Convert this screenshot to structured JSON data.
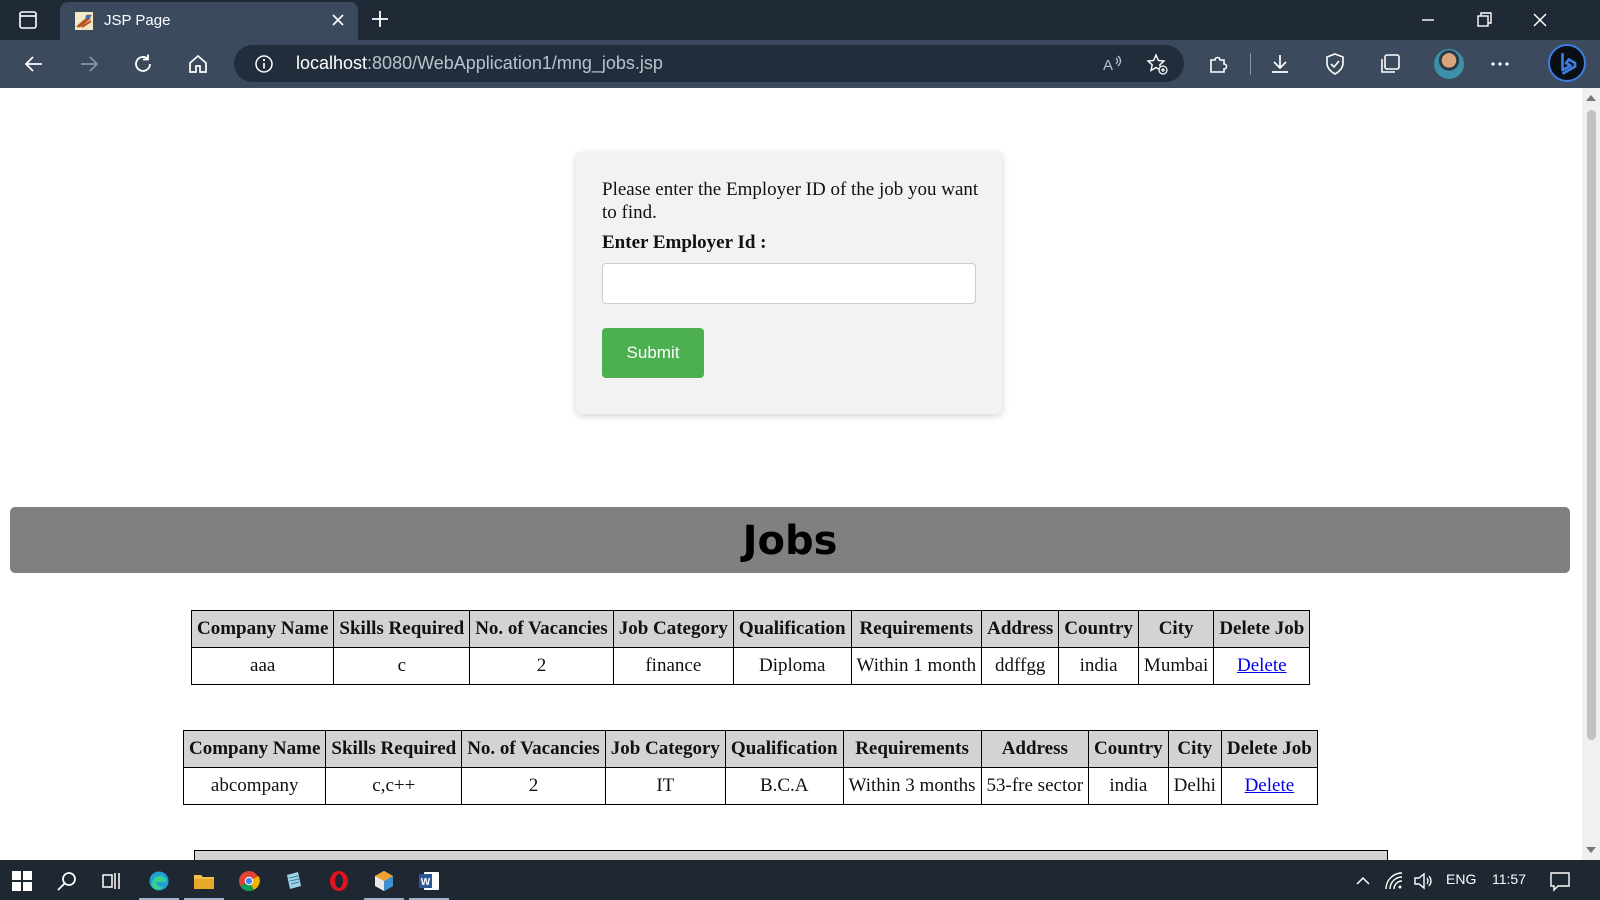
{
  "browser": {
    "tab": {
      "title": "JSP Page"
    },
    "address": {
      "host": "localhost",
      "rest": ":8080/WebApplication1/mng_jobs.jsp"
    }
  },
  "search_form": {
    "prompt": "Please enter the Employer ID of the job you want to find.",
    "field_label": "Enter Employer Id :",
    "input_value": "",
    "submit_label": "Submit"
  },
  "jobs": {
    "heading": "Jobs",
    "headers": [
      "Company Name",
      "Skills Required",
      "No. of Vacancies",
      "Job Category",
      "Qualification",
      "Requirements",
      "Address",
      "Country",
      "City",
      "Delete Job"
    ],
    "rows": [
      [
        "aaa",
        "c",
        "2",
        "finance",
        "Diploma",
        "Within 1 month",
        "ddffgg",
        "india",
        "Mumbai",
        "Delete"
      ],
      [
        "abcompany",
        "c,c++",
        "2",
        "IT",
        "B.C.A",
        "Within 3 months",
        "53-fre sector",
        "india",
        "Delhi",
        "Delete"
      ]
    ]
  },
  "taskbar": {
    "language": "ENG",
    "time": "11:57"
  },
  "colors": {
    "submit_button": "#4caf50",
    "jobs_header_bg": "#808080",
    "table_header_bg": "#d3d3d3",
    "link": "#0000ee"
  }
}
